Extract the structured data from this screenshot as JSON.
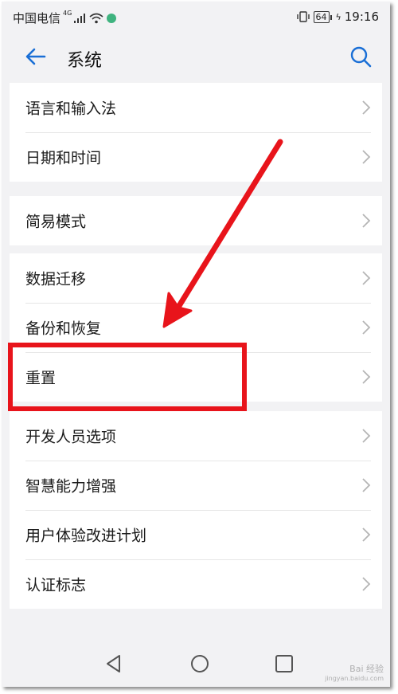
{
  "status_bar": {
    "carrier": "中国电信",
    "network": "4G",
    "battery": "64",
    "time": "19:16"
  },
  "header": {
    "title": "系统"
  },
  "groups": [
    {
      "items": [
        {
          "label": "语言和输入法"
        },
        {
          "label": "日期和时间"
        }
      ]
    },
    {
      "items": [
        {
          "label": "简易模式"
        }
      ]
    },
    {
      "items": [
        {
          "label": "数据迁移"
        },
        {
          "label": "备份和恢复"
        },
        {
          "label": "重置"
        }
      ]
    },
    {
      "items": [
        {
          "label": "开发人员选项"
        },
        {
          "label": "智慧能力增强"
        },
        {
          "label": "用户体验改进计划"
        },
        {
          "label": "认证标志"
        }
      ]
    }
  ],
  "watermark": {
    "line1": "Bai 经验",
    "line2": "jingyan.baidu.com"
  },
  "colors": {
    "accent": "#1a6fd6",
    "annotation": "#e8141b",
    "background": "#f2f2f4"
  },
  "icons": [
    "back-arrow-icon",
    "search-icon",
    "chevron-right-icon",
    "nav-back-icon",
    "nav-home-icon",
    "nav-recents-icon"
  ]
}
